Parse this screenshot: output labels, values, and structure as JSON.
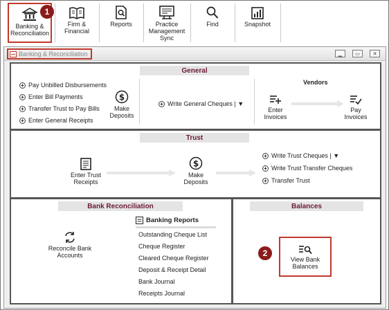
{
  "toolbar": {
    "items": [
      {
        "label": "Banking & Reconciliation",
        "icon": "bank-icon"
      },
      {
        "label": "Firm & Financial",
        "icon": "book-icon"
      },
      {
        "label": "Reports",
        "icon": "report-search-icon"
      },
      {
        "label": "Practice Management Sync",
        "icon": "practice-sync-icon"
      },
      {
        "label": "Find",
        "icon": "magnifier-icon"
      },
      {
        "label": "Snapshot",
        "icon": "chart-icon"
      }
    ]
  },
  "callouts": {
    "one": "1",
    "two": "2"
  },
  "window": {
    "title": "Banking & Reconciliation"
  },
  "general": {
    "header": "General",
    "links": [
      "Pay Unbilled Disbursements",
      "Enter Bill Payments",
      "Transfer Trust to Pay Bills",
      "Enter General Receipts"
    ],
    "make_deposits": "Make Deposits",
    "write_cheques": "Write General Cheques | ▼",
    "vendors": "Vendors",
    "enter_invoices": "Enter Invoices",
    "pay_invoices": "Pay Invoices"
  },
  "trust": {
    "header": "Trust",
    "enter_receipts": "Enter Trust Receipts",
    "make_deposits": "Make Deposits",
    "links": [
      "Write Trust Cheques | ▼",
      "Write Trust Transfer Cheques",
      "Transfer Trust"
    ]
  },
  "bank_rec": {
    "header": "Bank Reconciliation",
    "reconcile": "Reconcile Bank Accounts",
    "reports_title": "Banking Reports",
    "reports": [
      "Outstanding Cheque List",
      "Cheque Register",
      "Cleared Cheque Register",
      "Deposit & Receipt Detail",
      "Bank Journal",
      "Receipts Journal"
    ]
  },
  "balances": {
    "header": "Balances",
    "view": "View Bank Balances"
  },
  "colors": {
    "accent": "#6b1a3a",
    "highlight": "#c0392b",
    "badge": "#8b1a1a"
  }
}
